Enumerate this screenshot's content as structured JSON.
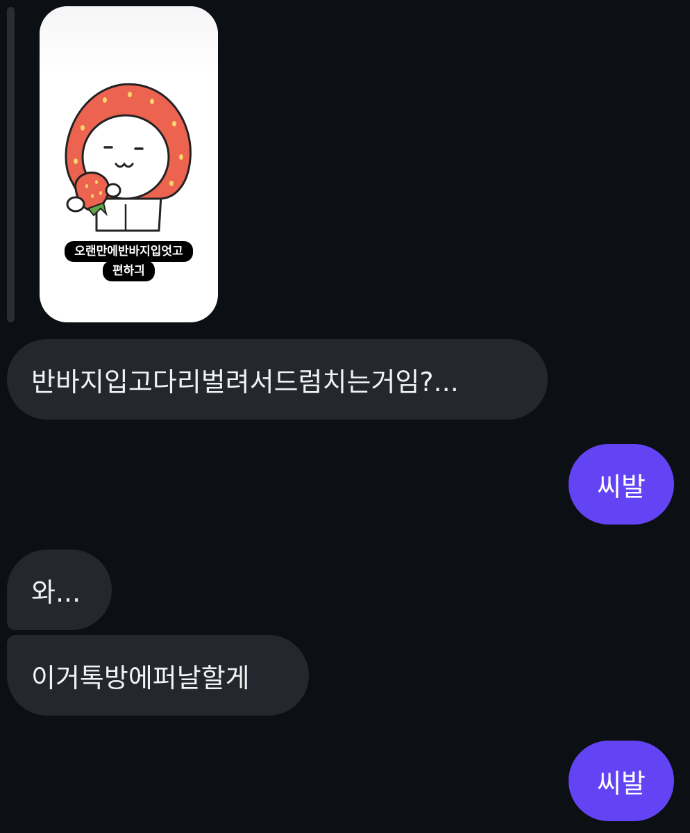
{
  "story_reply": {
    "caption_lines": [
      "오랜만에반바지입엇고",
      "편하긔"
    ],
    "sticker_icon": "strawberry-hood-character-sticker"
  },
  "messages": [
    {
      "direction": "incoming",
      "text": "반바지입고다리벌려서드럼치는거임?..."
    },
    {
      "direction": "outgoing",
      "text": "씨발"
    },
    {
      "direction": "incoming",
      "text": "와..."
    },
    {
      "direction": "incoming",
      "text": "이거톡방에퍼날할게"
    },
    {
      "direction": "outgoing",
      "text": "씨발"
    }
  ],
  "colors": {
    "background": "#0c0f14",
    "incoming_bubble": "#24272d",
    "outgoing_bubble": "#6344f5",
    "reply_bar": "#2a2d33",
    "sticker_red": "#ec6350"
  }
}
